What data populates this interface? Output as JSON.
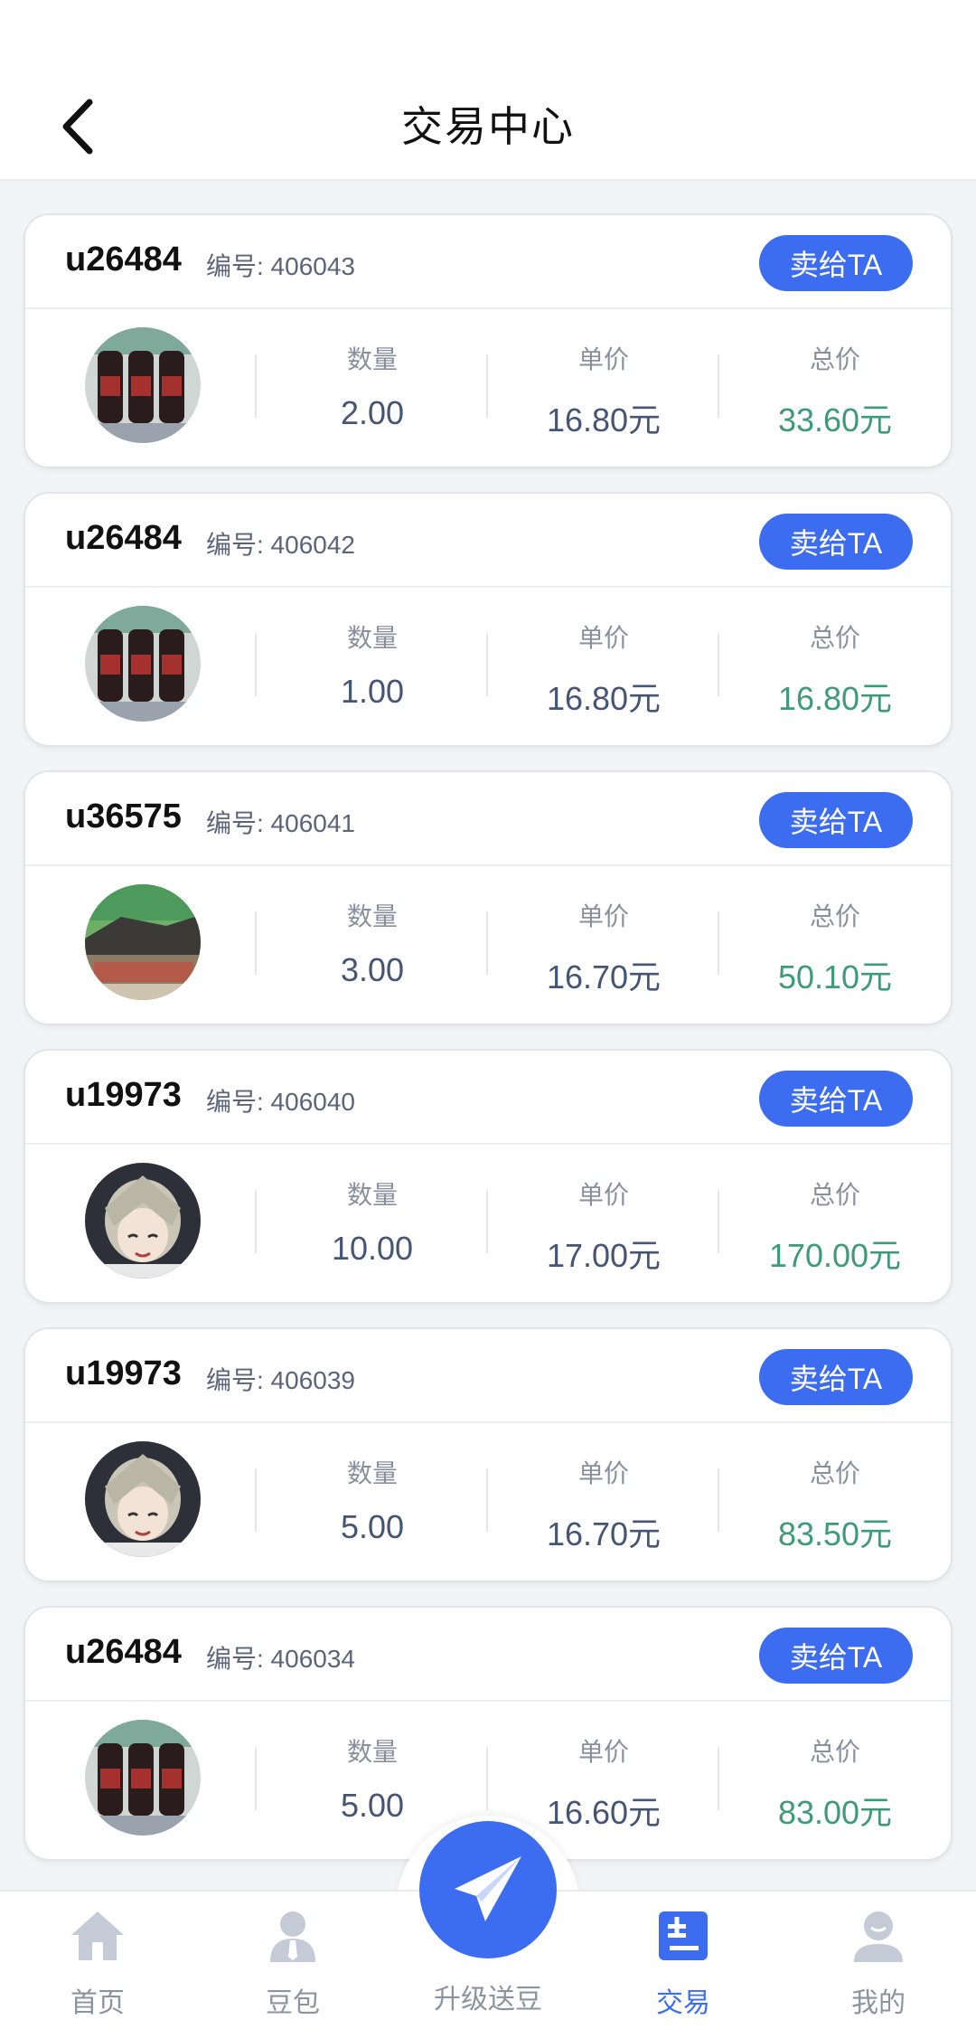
{
  "header": {
    "title": "交易中心"
  },
  "labels": {
    "qty": "数量",
    "unit_price": "单价",
    "total": "总价",
    "sell_button": "卖给TA"
  },
  "orders": [
    {
      "user": "u26484",
      "order_no": "编号: 406043",
      "qty": "2.00",
      "price": "16.80元",
      "total": "33.60元",
      "avatar": "wine-bottles"
    },
    {
      "user": "u26484",
      "order_no": "编号: 406042",
      "qty": "1.00",
      "price": "16.80元",
      "total": "16.80元",
      "avatar": "wine-bottles"
    },
    {
      "user": "u36575",
      "order_no": "编号: 406041",
      "qty": "3.00",
      "price": "16.70元",
      "total": "50.10元",
      "avatar": "landscape"
    },
    {
      "user": "u19973",
      "order_no": "编号: 406040",
      "qty": "10.00",
      "price": "17.00元",
      "total": "170.00元",
      "avatar": "anime-character"
    },
    {
      "user": "u19973",
      "order_no": "编号: 406039",
      "qty": "5.00",
      "price": "16.70元",
      "total": "83.50元",
      "avatar": "anime-character"
    },
    {
      "user": "u26484",
      "order_no": "编号: 406034",
      "qty": "5.00",
      "price": "16.60元",
      "total": "83.00元",
      "avatar": "wine-bottles"
    }
  ],
  "nav": {
    "home": "首页",
    "beans": "豆包",
    "upgrade": "升级送豆",
    "trade": "交易",
    "mine": "我的"
  },
  "colors": {
    "accent": "#3c6df0",
    "total_green": "#3e9a78",
    "value_slate": "#475575"
  }
}
